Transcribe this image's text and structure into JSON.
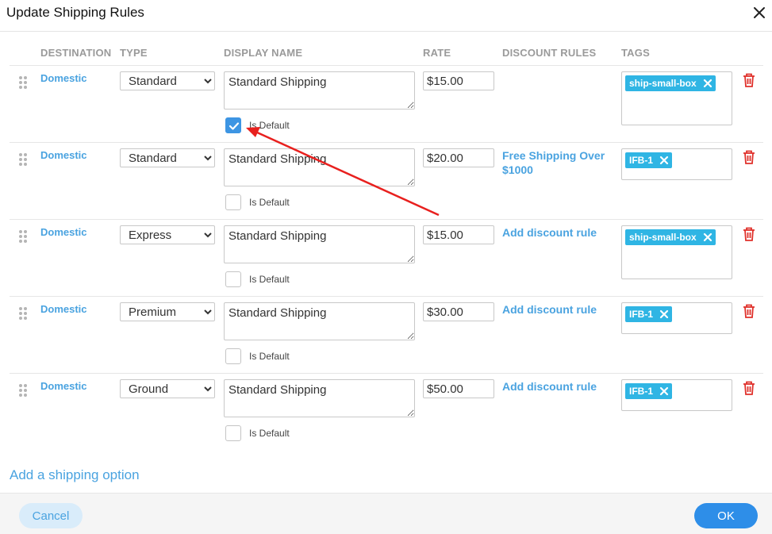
{
  "dialog": {
    "title": "Update Shipping Rules"
  },
  "columns": {
    "destination": "DESTINATION",
    "type": "TYPE",
    "display_name": "DISPLAY NAME",
    "rate": "RATE",
    "discount_rules": "DISCOUNT RULES",
    "tags": "TAGS"
  },
  "rows": [
    {
      "destination": "Domestic",
      "type": "Standard",
      "display_name": "Standard Shipping",
      "is_default_label": "Is Default",
      "is_default": true,
      "rate": "$15.00",
      "discount": "",
      "tag": "ship-small-box"
    },
    {
      "destination": "Domestic",
      "type": "Standard",
      "display_name": "Standard Shipping",
      "is_default_label": "Is Default",
      "is_default": false,
      "rate": "$20.00",
      "discount": "Free Shipping Over $1000",
      "tag": "IFB-1"
    },
    {
      "destination": "Domestic",
      "type": "Express",
      "display_name": "Standard Shipping",
      "is_default_label": "Is Default",
      "is_default": false,
      "rate": "$15.00",
      "discount": "Add discount rule",
      "tag": "ship-small-box"
    },
    {
      "destination": "Domestic",
      "type": "Premium",
      "display_name": "Standard Shipping",
      "is_default_label": "Is Default",
      "is_default": false,
      "rate": "$30.00",
      "discount": "Add discount rule",
      "tag": "IFB-1"
    },
    {
      "destination": "Domestic",
      "type": "Ground",
      "display_name": "Standard Shipping",
      "is_default_label": "Is Default",
      "is_default": false,
      "rate": "$50.00",
      "discount": "Add discount rule",
      "tag": "IFB-1"
    }
  ],
  "add_option": "Add a shipping option",
  "footer": {
    "cancel": "Cancel",
    "ok": "OK"
  },
  "colors": {
    "accent": "#4aa3e0",
    "tag": "#2fb5e4",
    "delete": "#e0322c",
    "annotation_arrow": "#e8201e"
  }
}
